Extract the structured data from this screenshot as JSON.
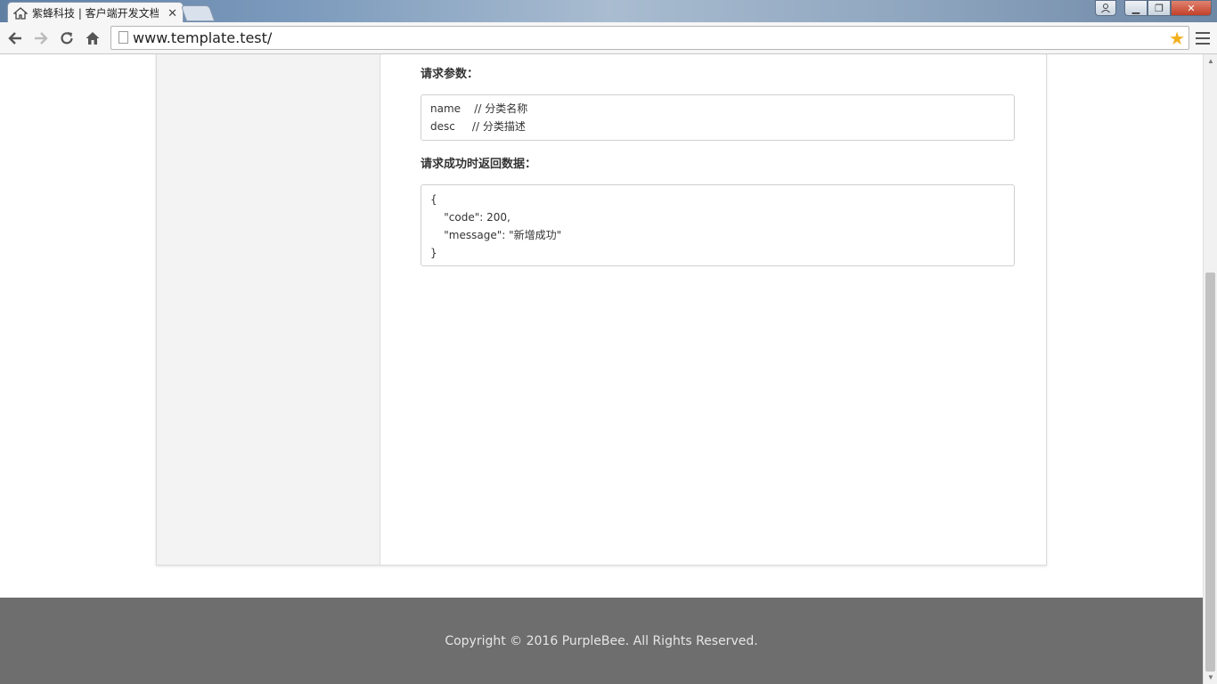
{
  "browser": {
    "tab_title": "紫蜂科技 | 客户端开发文档",
    "url": "www.template.test/",
    "icons": {
      "tab": "home-icon",
      "back": "back-arrow-icon",
      "forward": "forward-arrow-icon",
      "reload": "reload-icon",
      "home": "home-icon",
      "bookmark": "star-icon",
      "menu": "hamburger-menu-icon"
    }
  },
  "main": {
    "params_title": "请求参数：",
    "params_lines": [
      "name    // 分类名称",
      "desc     // 分类描述"
    ],
    "response_title": "请求成功时返回数据：",
    "response_lines": [
      "{",
      "    \"code\": 200,",
      "    \"message\": \"新增成功\"",
      "}"
    ]
  },
  "footer": {
    "copyright": "Copyright © 2016 PurpleBee. All Rights Reserved."
  },
  "colors": {
    "footer_bg": "#6e6e6e",
    "sidebar_bg": "#f3f3f3",
    "star": "#f2b01e"
  }
}
